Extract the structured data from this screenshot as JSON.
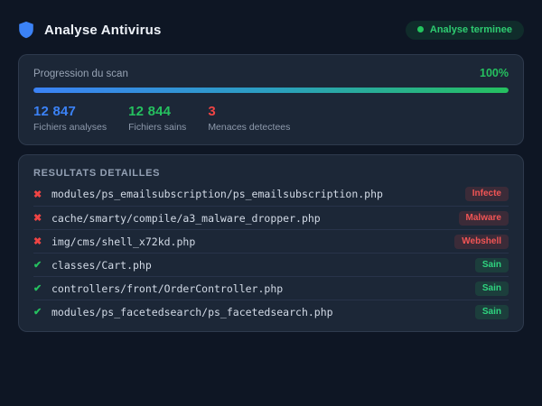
{
  "header": {
    "title": "Analyse Antivirus",
    "status": "Analyse terminee"
  },
  "progress_card": {
    "label": "Progression du scan",
    "percent": "100%",
    "percent_value": 100,
    "stats": [
      {
        "value": "12 847",
        "label": "Fichiers analyses",
        "color": "blue"
      },
      {
        "value": "12 844",
        "label": "Fichiers sains",
        "color": "green"
      },
      {
        "value": "3",
        "label": "Menaces detectees",
        "color": "red"
      }
    ]
  },
  "results_card": {
    "title": "RESULTATS DETAILLES",
    "rows": [
      {
        "status": "bad",
        "icon": "cross-icon",
        "path": "modules/ps_emailsubscription/ps_emailsubscription.php",
        "badge": "Infecte"
      },
      {
        "status": "bad",
        "icon": "cross-icon",
        "path": "cache/smarty/compile/a3_malware_dropper.php",
        "badge": "Malware"
      },
      {
        "status": "bad",
        "icon": "cross-icon",
        "path": "img/cms/shell_x72kd.php",
        "badge": "Webshell"
      },
      {
        "status": "good",
        "icon": "check-icon",
        "path": "classes/Cart.php",
        "badge": "Sain"
      },
      {
        "status": "good",
        "icon": "check-icon",
        "path": "controllers/front/OrderController.php",
        "badge": "Sain"
      },
      {
        "status": "good",
        "icon": "check-icon",
        "path": "modules/ps_facetedsearch/ps_facetedsearch.php",
        "badge": "Sain"
      }
    ]
  },
  "colors": {
    "background": "#0e1624",
    "card": "#1c2737",
    "accent_blue": "#3b82f6",
    "accent_green": "#25c05f",
    "accent_red": "#ef4444"
  },
  "icon_glyphs": {
    "cross-icon": "✖",
    "check-icon": "✔"
  }
}
